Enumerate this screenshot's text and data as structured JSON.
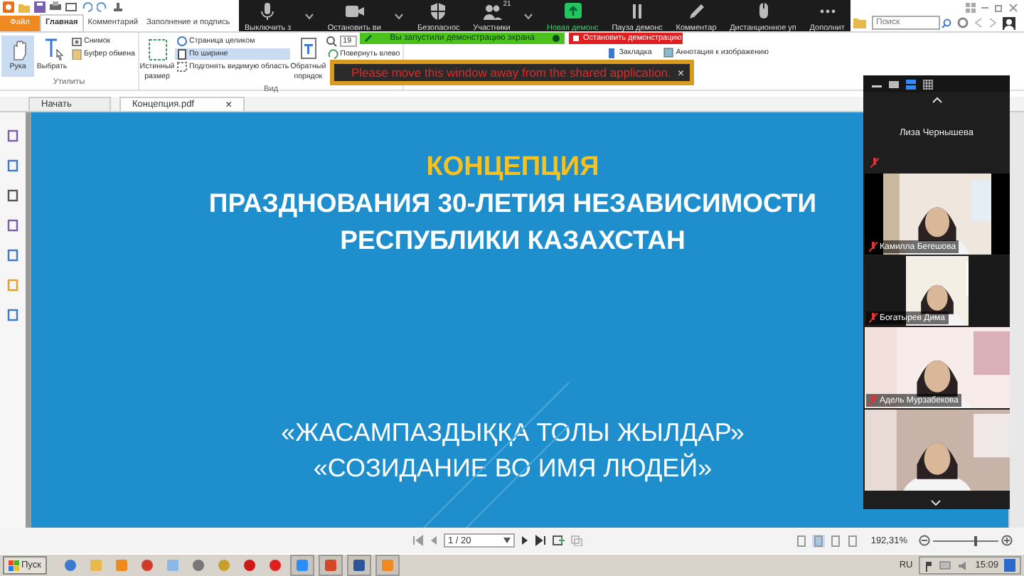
{
  "ribbon_tabs": [
    {
      "label": "Файл",
      "kind": "file",
      "selected": false
    },
    {
      "label": "Главная",
      "kind": "tab",
      "selected": true
    },
    {
      "label": "Комментарий",
      "kind": "tab",
      "selected": false
    },
    {
      "label": "Заполнение и подпись",
      "kind": "tab",
      "selected": false
    }
  ],
  "search": {
    "placeholder": "Поиск"
  },
  "ribbon_groups": [
    {
      "label": "Утилиты",
      "items": [
        {
          "kind": "large",
          "label": "Рука",
          "selected": true
        },
        {
          "kind": "large",
          "label": "Выбрать",
          "selected": false
        },
        {
          "kind": "stack",
          "items": [
            {
              "kind": "button",
              "label": "Снимок",
              "selected": false
            },
            {
              "kind": "button",
              "label": "Буфер обмена",
              "selected": false
            }
          ]
        }
      ]
    },
    {
      "label": "Вид",
      "items": [
        {
          "kind": "large",
          "label": "Истинный размер",
          "selected": false
        },
        {
          "kind": "stack",
          "items": [
            {
              "kind": "button",
              "label": "Страница целиком",
              "selected": false
            },
            {
              "kind": "button",
              "label": "По ширине",
              "selected": true
            },
            {
              "kind": "button",
              "label": "Подгонять видимую область",
              "selected": false
            }
          ]
        },
        {
          "kind": "large",
          "label": "Обратный порядок",
          "selected": false
        },
        {
          "kind": "stack",
          "items": [
            {
              "kind": "field",
              "label": "19"
            },
            {
              "kind": "button",
              "label": "Повернуть влево",
              "selected": false
            }
          ]
        }
      ]
    },
    {
      "items": [
        {
          "kind": "stack-mid",
          "items": [
            {
              "kind": "button",
              "label": "Закладка",
              "selected": false
            },
            {
              "kind": "button",
              "label": "Аннотация к изображению",
              "selected": false
            }
          ]
        }
      ]
    }
  ],
  "meeting_toolbar": [
    {
      "kind": "mic",
      "label": "Выключить з",
      "caret": true
    },
    {
      "kind": "video",
      "label": "Остановить ви",
      "caret": true
    },
    {
      "kind": "security",
      "label": "Безопаснос",
      "caret": false
    },
    {
      "kind": "participants",
      "label": "Участники",
      "badge": "21",
      "caret": true
    },
    {
      "kind": "share",
      "label": "Новая демонс",
      "caret": false
    },
    {
      "kind": "pause",
      "label": "Пауза демонс",
      "caret": false
    },
    {
      "kind": "annotate",
      "label": "Комментар",
      "caret": false
    },
    {
      "kind": "remote",
      "label": "Дистанционное уп",
      "caret": false
    },
    {
      "kind": "more",
      "label": "Дополнит",
      "caret": false
    }
  ],
  "share_banner": {
    "text": "Вы запустили демонстрацию экрана",
    "stop_button": "Остановить демонстрацию"
  },
  "warning": {
    "text": "Please move this window away from the shared application.",
    "close": "×"
  },
  "doc_tabs": [
    {
      "label": "Начать",
      "selected": false
    },
    {
      "label": "Концепция.pdf",
      "selected": true,
      "close": "×"
    }
  ],
  "slide": {
    "title": "КОНЦЕПЦИЯ",
    "subtitle": [
      "ПРАЗДНОВАНИЯ 30-ЛЕТИЯ НЕЗАВИСИМОСТИ",
      "РЕСПУБЛИКИ КАЗАХСТАН"
    ],
    "slogans": [
      "«ЖАСАМПАЗДЫҚҚА ТОЛЫ ЖЫЛДАР»",
      "«СОЗИДАНИЕ ВО ИМЯ ЛЮДЕЙ»"
    ]
  },
  "gallery": {
    "speaker": "Лиза Чернышева",
    "tiles": [
      {
        "name": "Камилла Бегешова",
        "kind": "wide"
      },
      {
        "name": "Богатырев Дима",
        "kind": "narrow"
      },
      {
        "name": "Адель Мурзабекова",
        "kind": "full"
      },
      {
        "kind": "full"
      }
    ]
  },
  "status_bar": {
    "page": "1 / 20",
    "zoom": "192,31%",
    "zoom_level": {
      "level": 0.62
    }
  },
  "taskbar": {
    "start": "Пуск",
    "language": "RU",
    "time": "15:09"
  }
}
